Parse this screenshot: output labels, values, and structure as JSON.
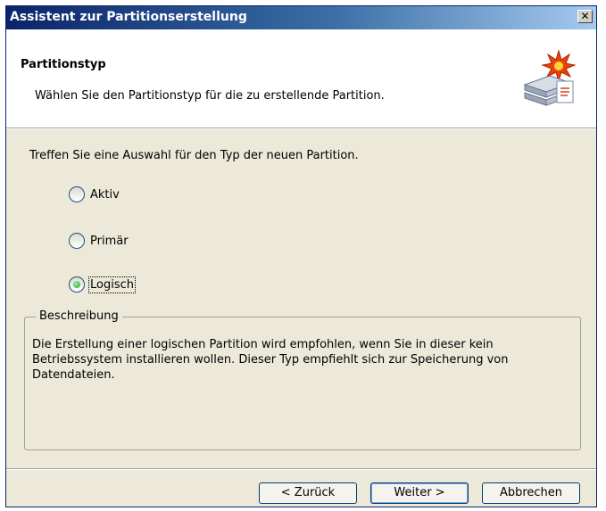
{
  "window": {
    "title": "Assistent zur Partitionserstellung",
    "close_glyph": "✕"
  },
  "header": {
    "title": "Partitionstyp",
    "subtitle": "Wählen Sie den Partitionstyp für die zu erstellende Partition.",
    "icon": "disk-wizard-icon"
  },
  "prompt": "Treffen Sie eine Auswahl für den Typ der neuen Partition.",
  "options": [
    {
      "label": "Aktiv",
      "checked": false
    },
    {
      "label": "Primär",
      "checked": false
    },
    {
      "label": "Logisch",
      "checked": true
    }
  ],
  "description": {
    "legend": "Beschreibung",
    "text": "Die Erstellung einer logischen Partition wird empfohlen, wenn Sie in dieser kein Betriebssystem installieren wollen. Dieser Typ empfiehlt sich zur Speicherung von Datendateien."
  },
  "buttons": {
    "back": "< Zurück",
    "next": "Weiter >",
    "cancel": "Abbrechen"
  },
  "colors": {
    "titlebar_start": "#0a246a",
    "titlebar_end": "#a6caf0",
    "dialog_bg": "#ece9d8",
    "radio_checked": "#2aa12a"
  }
}
